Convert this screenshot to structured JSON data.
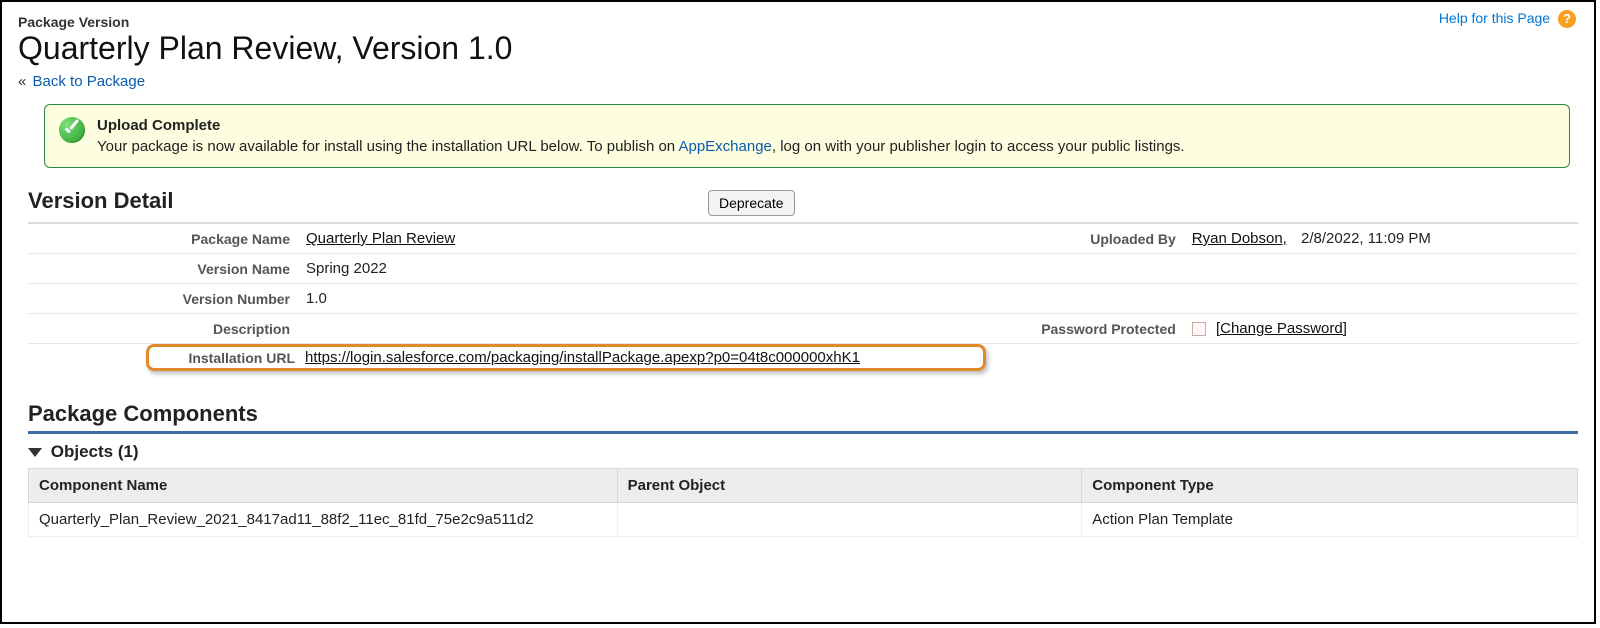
{
  "help": {
    "label": "Help for this Page"
  },
  "header": {
    "eyebrow": "Package Version",
    "title": "Quarterly Plan Review, Version 1.0",
    "back_prefix": "«",
    "back_label": "Back to Package"
  },
  "alert": {
    "title": "Upload Complete",
    "body_before": "Your package is now available for install using the installation URL below. To publish on ",
    "body_link": "AppExchange",
    "body_after": ", log on with your publisher login to access your public listings."
  },
  "detail": {
    "section_label": "Version Detail",
    "deprecate_label": "Deprecate",
    "package_name_label": "Package Name",
    "package_name": "Quarterly Plan Review",
    "version_name_label": "Version Name",
    "version_name": "Spring 2022",
    "version_number_label": "Version Number",
    "version_number": "1.0",
    "description_label": "Description",
    "description": "",
    "installation_url_label": "Installation URL",
    "installation_url": "https://login.salesforce.com/packaging/installPackage.apexp?p0=04t8c000000xhK1",
    "uploaded_by_label": "Uploaded By",
    "uploaded_by_name": "Ryan Dobson,",
    "uploaded_by_date": "2/8/2022, 11:09 PM",
    "password_protected_label": "Password Protected",
    "change_password_label": "[Change Password]"
  },
  "components": {
    "section_label": "Package Components",
    "objects_label": "Objects (1)",
    "columns": {
      "name": "Component Name",
      "parent": "Parent Object",
      "type": "Component Type"
    },
    "rows": [
      {
        "name": "Quarterly_Plan_Review_2021_8417ad11_88f2_11ec_81fd_75e2c9a511d2",
        "parent": "",
        "type": "Action Plan Template"
      }
    ]
  }
}
